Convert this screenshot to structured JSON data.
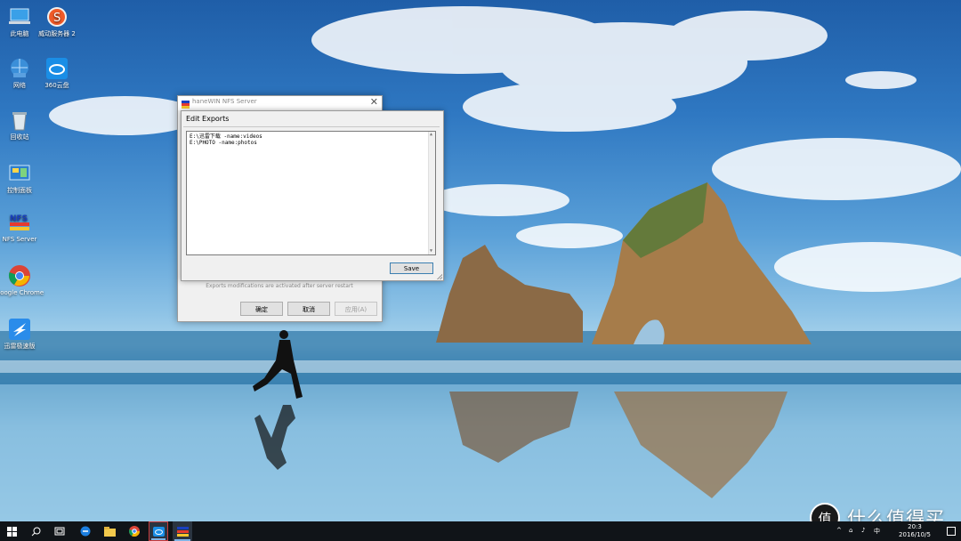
{
  "desktop": {
    "icons": [
      {
        "label": "此电脑",
        "icon": "this-pc-icon"
      },
      {
        "label": "威动服务器 2",
        "icon": "s-server-icon"
      },
      {
        "label": "网络",
        "icon": "network-icon"
      },
      {
        "label": "360云盘",
        "icon": "cloud-drive-icon"
      },
      {
        "label": "回收站",
        "icon": "recycle-bin-icon"
      },
      {
        "label": "控制面板",
        "icon": "control-panel-icon"
      },
      {
        "label": "NFS Server",
        "icon": "nfs-server-icon"
      },
      {
        "label": "Google Chrome",
        "icon": "chrome-icon"
      },
      {
        "label": "迅雷极速版",
        "icon": "thunder-icon"
      }
    ]
  },
  "main_window": {
    "title": "haneWIN NFS Server",
    "status_text": "Exports modifications are activated after server restart",
    "buttons": {
      "ok": "确定",
      "cancel": "取消",
      "apply": "应用(A)"
    }
  },
  "edit_exports": {
    "title": "Edit Exports",
    "lines": [
      "E:\\迅雷下载 -name:videos",
      "E:\\PHOTO -name:photos"
    ],
    "save_label": "Save"
  },
  "taskbar": {
    "clock_time": "20:3",
    "clock_date": "2016/10/5",
    "apps": [
      "start-icon",
      "search-icon",
      "task-view-icon",
      "edge-icon",
      "file-explorer-icon",
      "chrome-icon",
      "cloud-drive-icon",
      "nfs-server-icon"
    ]
  },
  "watermark": {
    "text": "什么值得买",
    "glyph": "值"
  },
  "colors": {
    "taskbar": "#101418",
    "sky": "#2f78c2",
    "window_bg": "#f0f0f0"
  }
}
